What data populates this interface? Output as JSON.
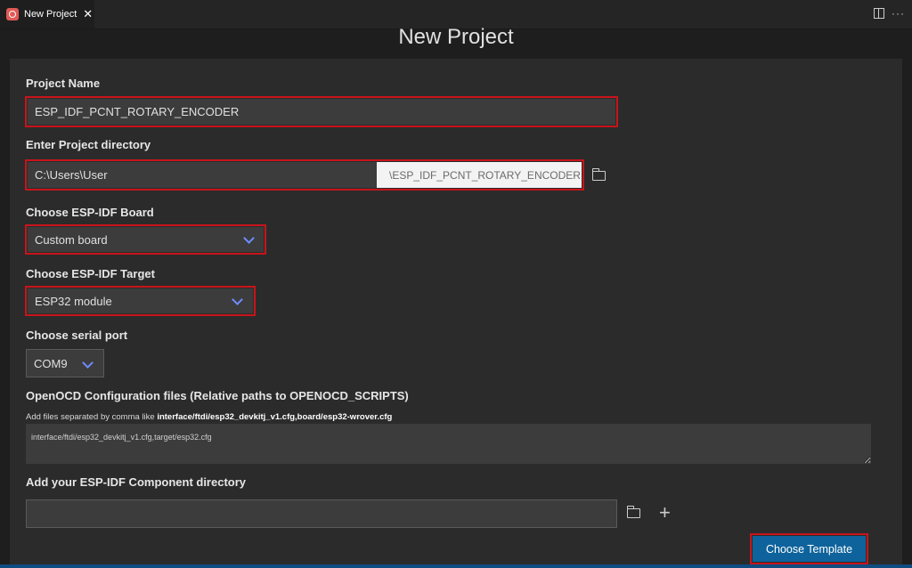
{
  "tab": {
    "label": "New Project",
    "close": "✕",
    "more": "···"
  },
  "page": {
    "title": "New Project"
  },
  "project_name": {
    "label": "Project Name",
    "value": "ESP_IDF_PCNT_ROTARY_ENCODER"
  },
  "project_dir": {
    "label": "Enter Project directory",
    "value": "C:\\Users\\User",
    "suffix": "\\ESP_IDF_PCNT_ROTARY_ENCODER"
  },
  "board": {
    "label": "Choose ESP-IDF Board",
    "selected": "Custom board"
  },
  "target": {
    "label": "Choose ESP-IDF Target",
    "selected": "ESP32 module"
  },
  "serial_port": {
    "label": "Choose serial port",
    "selected": "COM9"
  },
  "openocd": {
    "label": "OpenOCD Configuration files (Relative paths to OPENOCD_SCRIPTS)",
    "helper_prefix": "Add files separated by comma like ",
    "helper_example": "interface/ftdi/esp32_devkitj_v1.cfg,board/esp32-wrover.cfg",
    "value": "interface/ftdi/esp32_devkitj_v1.cfg,target/esp32.cfg"
  },
  "component_dir": {
    "label": "Add your ESP-IDF Component directory",
    "value": "",
    "plus": "+"
  },
  "actions": {
    "choose_template": "Choose Template"
  },
  "colors": {
    "highlight": "#c8141b",
    "accent": "#0e639c",
    "chevron": "#6f8cff"
  }
}
